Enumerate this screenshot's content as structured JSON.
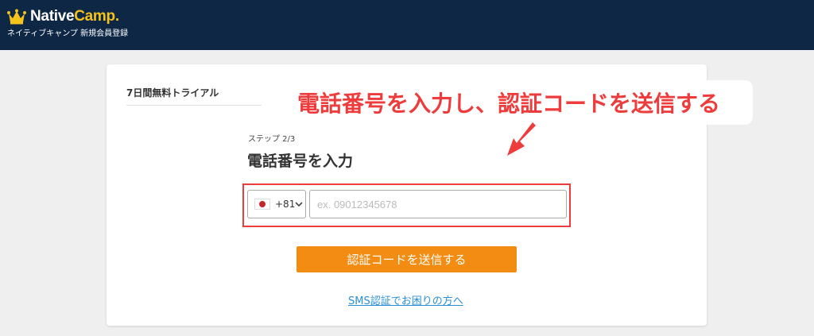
{
  "header": {
    "brand_prefix": "Native",
    "brand_suffix": "Camp.",
    "subtitle": "ネイティブキャンプ 新規会員登録"
  },
  "card": {
    "trial_label": "7日間無料トライアル",
    "step_label": "ステップ 2/3",
    "heading": "電話番号を入力",
    "country": {
      "flag": "japan-flag",
      "dial_code": "+81"
    },
    "phone": {
      "value": "",
      "placeholder": "ex. 09012345678"
    },
    "send_button": "認証コードを送信する",
    "sms_help_link": "SMS認証でお困りの方へ"
  },
  "annotation": {
    "callout_text": "電話番号を入力し、認証コードを送信する"
  },
  "colors": {
    "header_bg": "#0d2745",
    "accent_yellow": "#f6c21c",
    "button_orange": "#f28c13",
    "annotation_red": "#ee3b3b",
    "link_blue": "#2a8fd6"
  }
}
